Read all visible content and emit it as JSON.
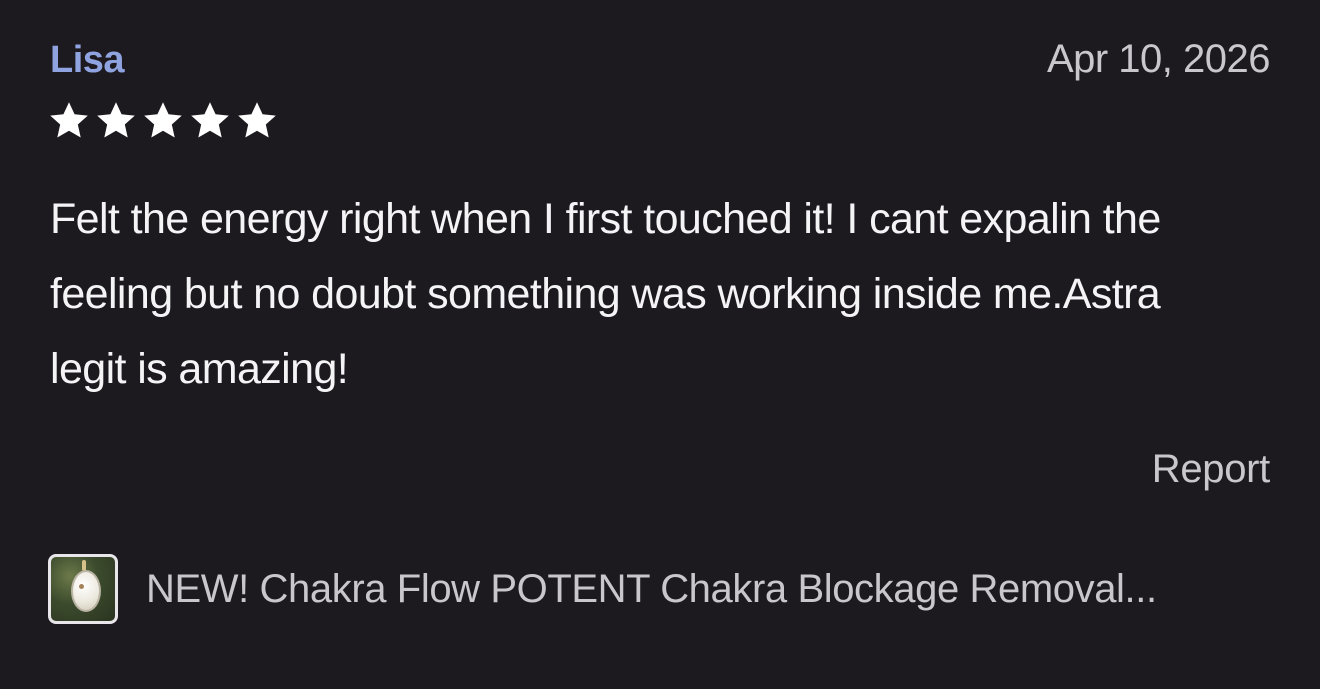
{
  "review": {
    "reviewer_name": "Lisa",
    "date": "Apr 10, 2026",
    "rating": 5,
    "rating_max": 5,
    "text": "Felt the energy right when I first touched it! I cant expalin the feeling but no doubt something was working inside me.Astra legit is amazing!",
    "report_label": "Report"
  },
  "product": {
    "title": "NEW! Chakra Flow POTENT Chakra Blockage Removal...",
    "thumbnail_icon": "pendant-thumbnail"
  },
  "colors": {
    "background": "#1c1a1e",
    "name_accent": "#8fa3e0",
    "primary_text": "#f4f3f6",
    "secondary_text": "#c9c6cc",
    "star": "#ffffff"
  }
}
